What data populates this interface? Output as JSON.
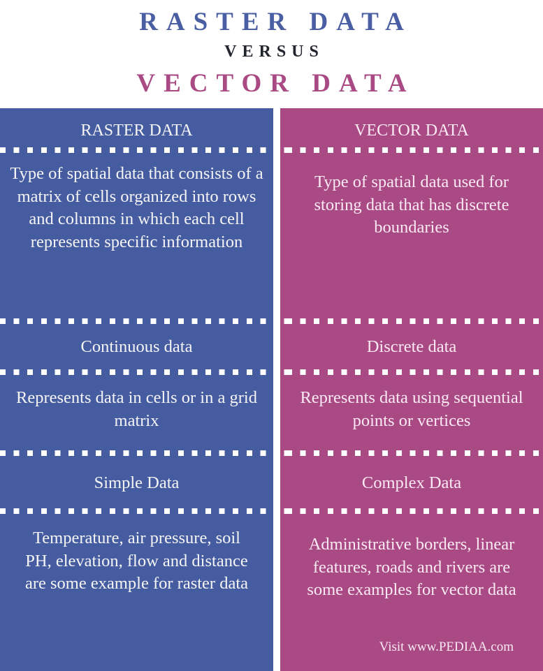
{
  "header": {
    "title_top": "RASTER DATA",
    "versus": "VERSUS",
    "title_bottom": "VECTOR DATA"
  },
  "colors": {
    "raster": "#465CA0",
    "vector": "#A94A85",
    "title_raster": "#4A5FA3",
    "title_vector": "#A94A85",
    "versus": "#22252E"
  },
  "columns": {
    "raster": {
      "heading": "RASTER DATA",
      "rows": [
        "Type of spatial data that consists of a matrix of cells organized into rows and columns in which each cell represents specific information",
        "Continuous data",
        "Represents data in cells or in a grid matrix",
        "Simple Data",
        "Temperature, air pressure, soil PH, elevation, flow and distance are some example for raster data"
      ]
    },
    "vector": {
      "heading": "VECTOR DATA",
      "rows": [
        "Type of spatial data used for storing data that has discrete boundaries",
        "Discrete data",
        "Represents data using sequential points or vertices",
        "Complex Data",
        "Administrative borders, linear features, roads and rivers are some examples for vector data"
      ]
    }
  },
  "footer": {
    "credit": "Visit www.PEDIAA.com"
  }
}
